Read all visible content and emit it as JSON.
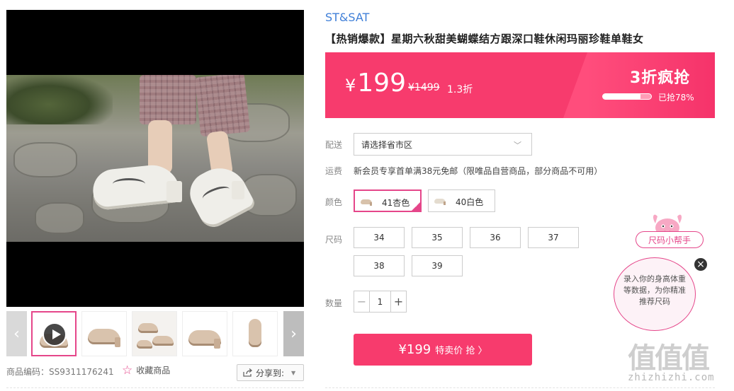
{
  "product": {
    "brand": "ST&SAT",
    "title": "【热销爆款】星期六秋甜美蝴蝶结方跟深口鞋休闲玛丽珍鞋单鞋女",
    "sku_label": "商品编码：SS9311176241"
  },
  "price": {
    "currency": "¥",
    "current": "199",
    "original": "¥1499",
    "discount": "1.3折",
    "flash_label": "3折疯抢",
    "sold_label": "已抢78%",
    "sold_progress": 0.78
  },
  "shipping": {
    "label": "配送",
    "region_placeholder": "请选择省市区",
    "fee_label": "运费",
    "fee_text": "新会员专享首单满38元免邮（限唯品自营商品，部分商品不可用）"
  },
  "colors": {
    "label": "颜色",
    "options": [
      {
        "name": "41杏色",
        "selected": true
      },
      {
        "name": "40白色",
        "selected": false
      }
    ]
  },
  "sizes": {
    "label": "尺码",
    "options": [
      "34",
      "35",
      "36",
      "37",
      "38",
      "39"
    ]
  },
  "quantity": {
    "label": "数量",
    "value": "1",
    "minus": "−",
    "plus": "+"
  },
  "buy_button": {
    "price": "¥199",
    "text": "特卖价 抢 〉"
  },
  "actions": {
    "favorite": "收藏商品",
    "share": "分享到:"
  },
  "size_helper": {
    "tag": "尺码小帮手",
    "bubble": "录入你的身高体重等数据，为你精准推荐尺码",
    "close": "×"
  },
  "watermark": {
    "logo": "值值值",
    "url": "zhizhizhi.com"
  },
  "theme": {
    "accent": "#f73b6d",
    "pink_border": "#e5468a",
    "brand_blue": "#3f7fd8"
  },
  "icons": [
    "play-icon",
    "star-icon",
    "share-icon",
    "chevron-down-icon",
    "close-icon",
    "arrow-left-icon",
    "arrow-right-icon",
    "mascot-icon"
  ]
}
